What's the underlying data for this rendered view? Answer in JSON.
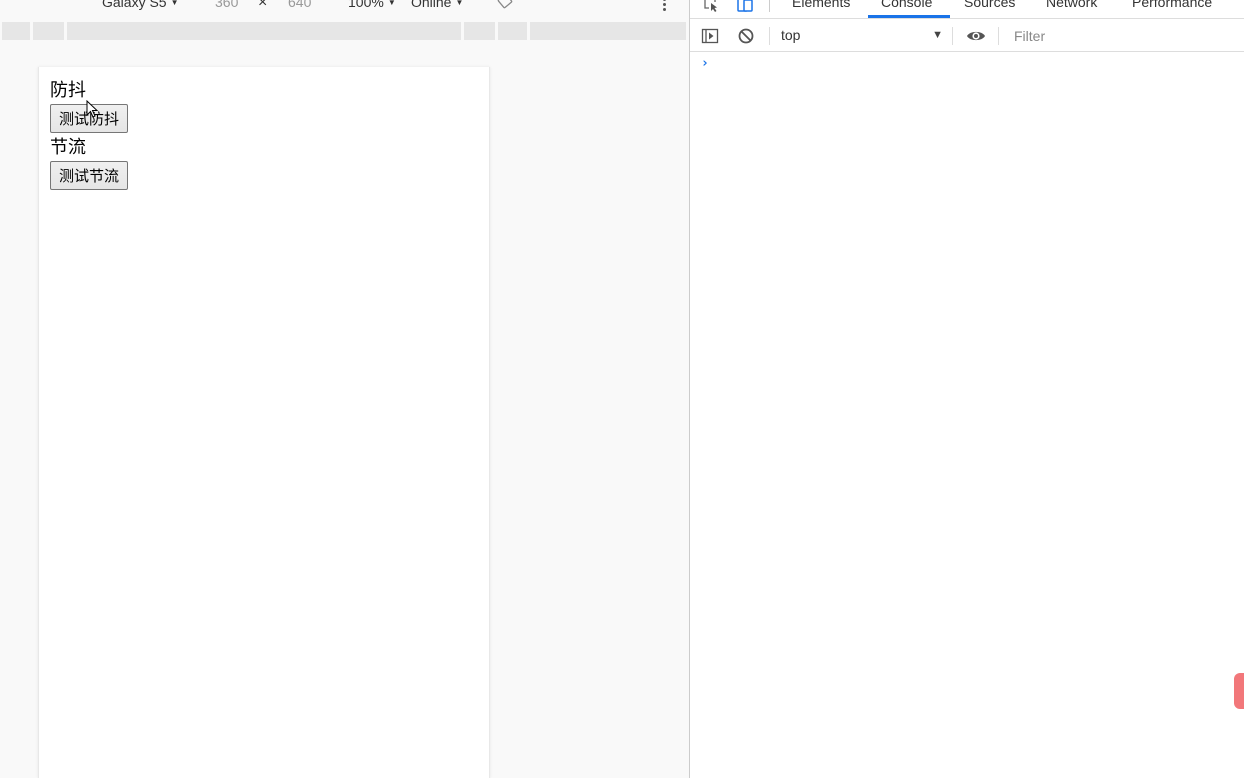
{
  "device_toolbar": {
    "device": "Galaxy S5",
    "width": "360",
    "times": "×",
    "height": "640",
    "zoom": "100%",
    "throttling": "Online",
    "arrow": "▼"
  },
  "page": {
    "debounce_heading": "防抖",
    "debounce_button": "测试防抖",
    "throttle_heading": "节流",
    "throttle_button": "测试节流"
  },
  "devtools": {
    "tabs": [
      "Elements",
      "Console",
      "Sources",
      "Network",
      "Performance"
    ],
    "active_tab": "Console",
    "context": "top",
    "context_caret": "▼",
    "filter_placeholder": "Filter",
    "prompt": "›"
  },
  "colors": {
    "accent": "#1a73e8",
    "badge": "#f2777a"
  }
}
